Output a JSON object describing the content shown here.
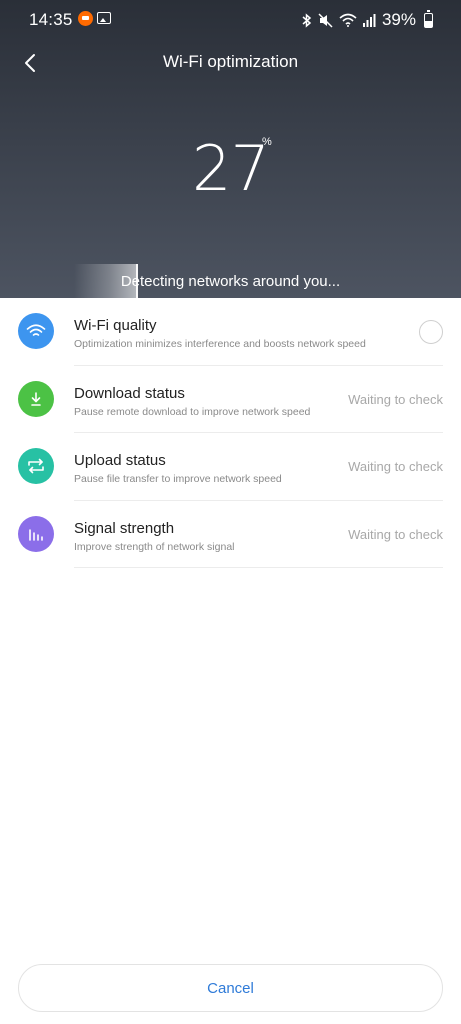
{
  "statusbar": {
    "time": "14:35",
    "battery_percent": "39%"
  },
  "header": {
    "title": "Wi-Fi optimization",
    "progress_value": "27",
    "progress_unit": "%",
    "detecting_text": "Detecting networks around you..."
  },
  "checks": [
    {
      "title": "Wi-Fi quality",
      "subtitle": "Optimization minimizes interference and boosts network speed",
      "status": "",
      "icon": "wifi-icon",
      "color": "#3d95ef"
    },
    {
      "title": "Download status",
      "subtitle": "Pause remote download to improve network speed",
      "status": "Waiting to check",
      "icon": "download-icon",
      "color": "#4cc245"
    },
    {
      "title": "Upload status",
      "subtitle": "Pause file transfer to improve network speed",
      "status": "Waiting to check",
      "icon": "transfer-icon",
      "color": "#27c1a4"
    },
    {
      "title": "Signal strength",
      "subtitle": "Improve strength of network signal",
      "status": "Waiting to check",
      "icon": "signal-bars-icon",
      "color": "#8b6ee9"
    }
  ],
  "footer": {
    "cancel_label": "Cancel"
  }
}
